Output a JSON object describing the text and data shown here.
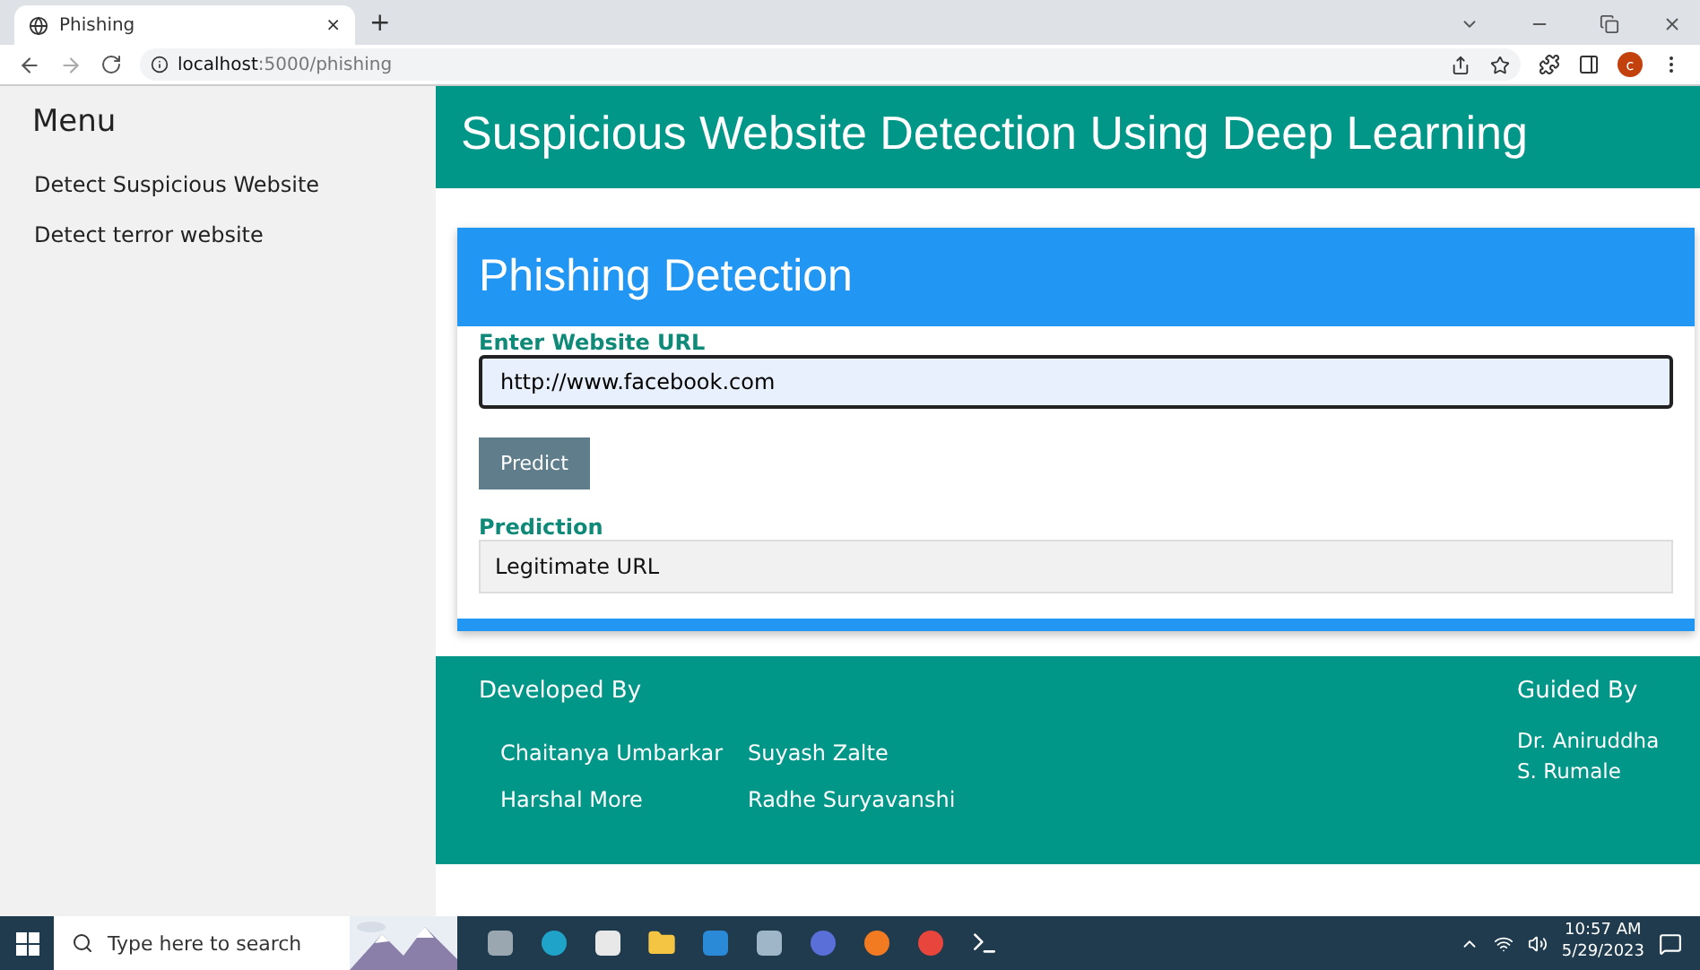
{
  "browser": {
    "tab": {
      "title": "Phishing",
      "close": "×",
      "selected": true
    },
    "new_tab": "+",
    "url_host": "localhost",
    "url_path": ":5000/phishing",
    "profile": "c"
  },
  "sidebar": {
    "title": "Menu",
    "items": [
      {
        "label": "Detect Suspicious Website"
      },
      {
        "label": "Detect terror website"
      }
    ]
  },
  "header": {
    "title": "Suspicious Website Detection Using Deep Learning"
  },
  "card": {
    "title": "Phishing Detection",
    "url_label": "Enter Website URL",
    "url_value": "http://www.facebook.com",
    "button": "Predict",
    "prediction_label": "Prediction",
    "prediction_value": "Legitimate URL"
  },
  "footer": {
    "developed_title": "Developed By",
    "developers": [
      "Chaitanya Umbarkar",
      "Suyash Zalte",
      "Harshal More",
      "Radhe Suryavanshi"
    ],
    "guided_title": "Guided By",
    "guide": "Dr. Aniruddha S. Rumale"
  },
  "taskbar": {
    "search_placeholder": "Type here to search",
    "time": "10:57 AM",
    "date": "5/29/2023"
  }
}
